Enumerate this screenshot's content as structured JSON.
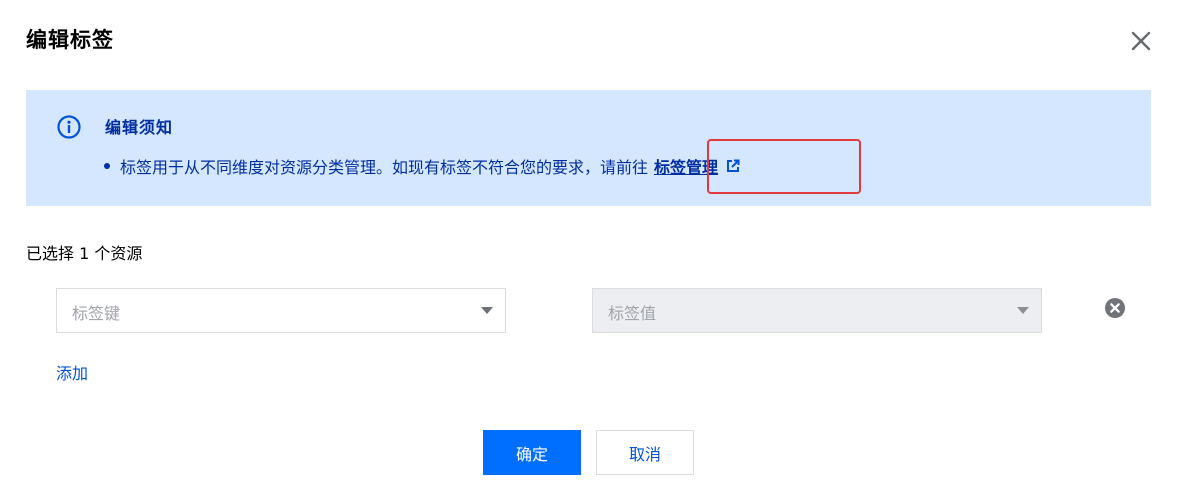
{
  "dialog": {
    "title": "编辑标签"
  },
  "notice": {
    "title": "编辑须知",
    "text": "标签用于从不同维度对资源分类管理。如现有标签不符合您的要求，请前往",
    "link_label": "标签管理"
  },
  "selection": {
    "info": "已选择 1 个资源"
  },
  "tag_row": {
    "key_placeholder": "标签键",
    "value_placeholder": "标签值"
  },
  "actions": {
    "add_label": "添加",
    "confirm_label": "确定",
    "cancel_label": "取消"
  },
  "icons": {
    "close": "close-icon",
    "info": "info-circle-icon",
    "external_link": "external-link-icon",
    "remove": "remove-circle-icon",
    "dropdown": "caret-down-icon"
  },
  "colors": {
    "primary": "#006eff",
    "link": "#0052d9",
    "notice_bg": "#d5e7ff",
    "notice_text": "#002da0",
    "highlight": "#e0393e"
  }
}
